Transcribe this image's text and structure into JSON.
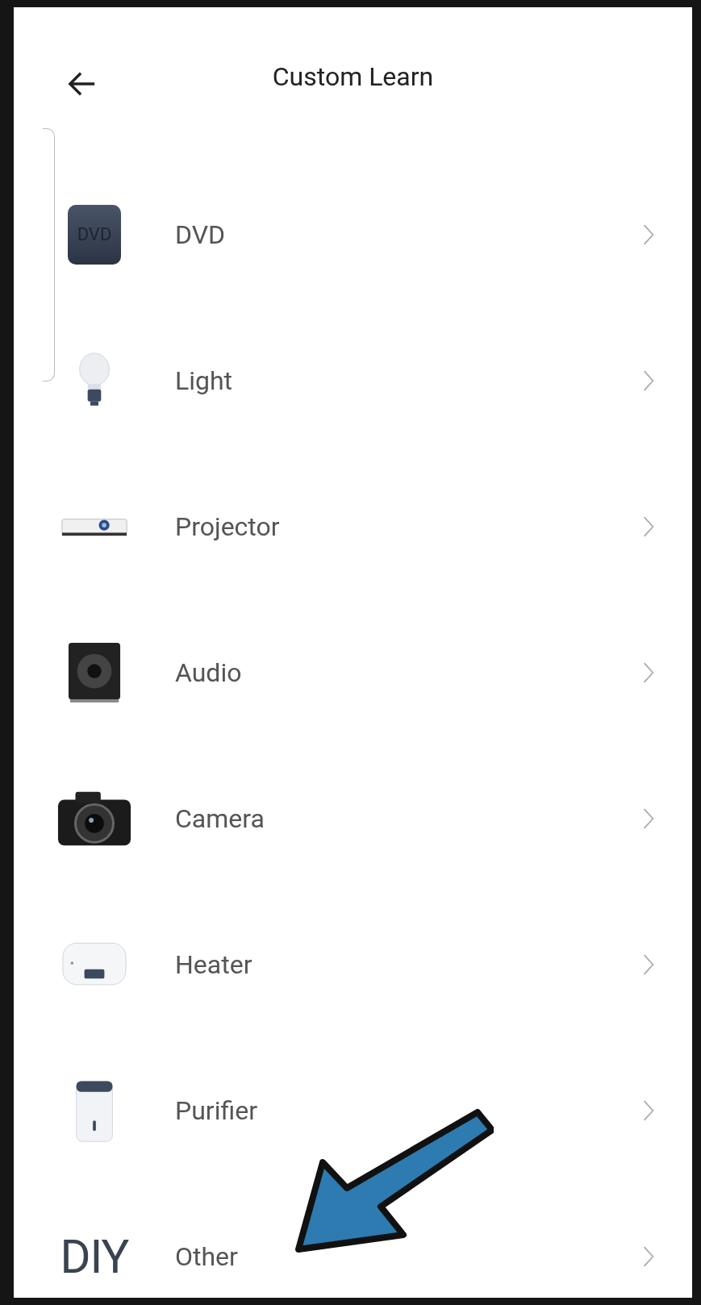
{
  "header": {
    "title": "Custom Learn"
  },
  "items": [
    {
      "kind": "dvd",
      "label": "DVD",
      "icon_text": "DVD"
    },
    {
      "kind": "light",
      "label": "Light"
    },
    {
      "kind": "projector",
      "label": "Projector"
    },
    {
      "kind": "audio",
      "label": "Audio"
    },
    {
      "kind": "camera",
      "label": "Camera"
    },
    {
      "kind": "heater",
      "label": "Heater"
    },
    {
      "kind": "purifier",
      "label": "Purifier"
    },
    {
      "kind": "diy",
      "label": "Other",
      "icon_text": "DIY"
    }
  ]
}
